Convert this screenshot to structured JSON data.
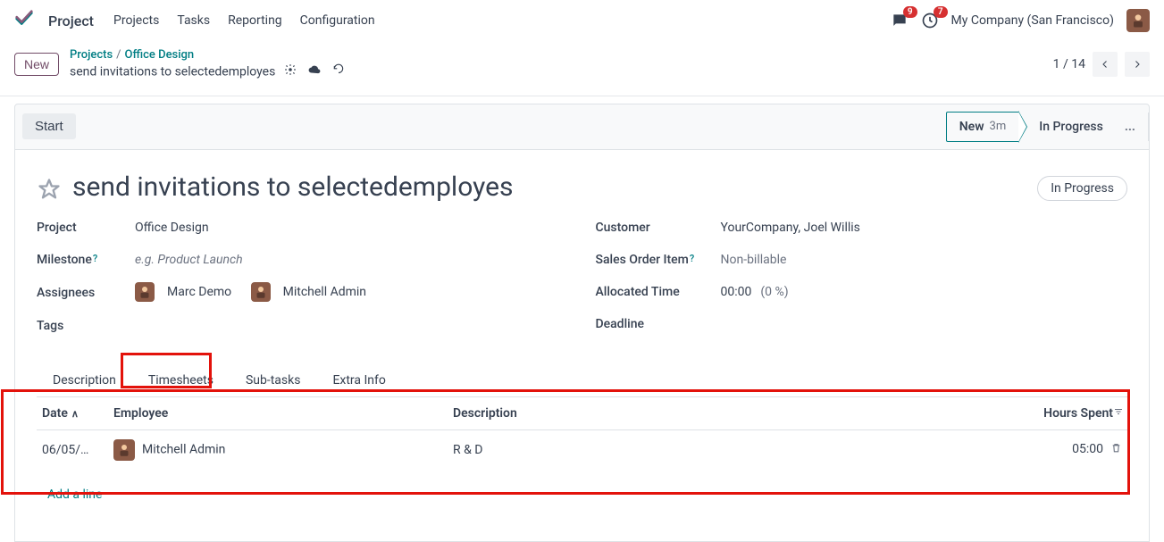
{
  "nav": {
    "app": "Project",
    "items": [
      "Projects",
      "Tasks",
      "Reporting",
      "Configuration"
    ],
    "company": "My Company (San Francisco)",
    "chat_badge": "9",
    "clock_badge": "7"
  },
  "breadcrumb": {
    "new_btn": "New",
    "projects": "Projects",
    "project": "Office Design",
    "task": "send invitations to selectedemployes",
    "pager": "1 / 14"
  },
  "status": {
    "start": "Start",
    "current_name": "New",
    "current_age": "3m",
    "next": "In Progress",
    "more": "..."
  },
  "task": {
    "title": "send invitations to selectedemployes",
    "state_pill": "In Progress",
    "project_label": "Project",
    "project_value": "Office Design",
    "milestone_label": "Milestone",
    "milestone_placeholder": "e.g. Product Launch",
    "assignees_label": "Assignees",
    "assignees": [
      "Marc Demo",
      "Mitchell Admin"
    ],
    "tags_label": "Tags",
    "customer_label": "Customer",
    "customer_value": "YourCompany, Joel Willis",
    "soi_label": "Sales Order Item",
    "soi_value": "Non-billable",
    "alloc_label": "Allocated Time",
    "alloc_value": "00:00",
    "alloc_pct": "(0 %)",
    "deadline_label": "Deadline"
  },
  "tabs": [
    "Description",
    "Timesheets",
    "Sub-tasks",
    "Extra Info"
  ],
  "timesheet": {
    "col_date": "Date",
    "col_emp": "Employee",
    "col_desc": "Description",
    "col_hours": "Hours Spent",
    "rows": [
      {
        "date": "06/05/…",
        "employee": "Mitchell Admin",
        "description": "R & D",
        "hours": "05:00"
      }
    ],
    "add": "Add a line"
  }
}
